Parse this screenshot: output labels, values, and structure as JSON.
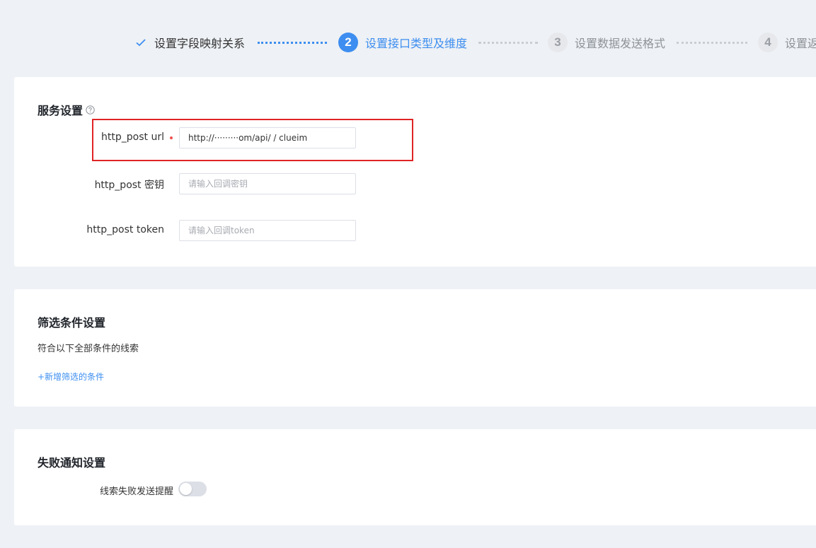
{
  "steps": [
    {
      "label": "设置字段映射关系",
      "state": "done",
      "icon": "check-icon"
    },
    {
      "number": "2",
      "label": "设置接口类型及维度",
      "state": "active"
    },
    {
      "number": "3",
      "label": "设置数据发送格式",
      "state": "todo"
    },
    {
      "number": "4",
      "label": "设置返",
      "state": "todo"
    }
  ],
  "service": {
    "title": "服务设置",
    "help_icon": "question-circle-icon",
    "url_label": "http_post url",
    "url_value": "http://·········om/api/ / clueim",
    "secret_label": "http_post 密钥",
    "secret_placeholder": "请输入回调密钥",
    "token_label": "http_post token",
    "token_placeholder": "请输入回调token"
  },
  "filter": {
    "title": "筛选条件设置",
    "description": "符合以下全部条件的线索",
    "add_label": "+新增筛选的条件"
  },
  "failure": {
    "title": "失败通知设置",
    "toggle_label": "线索失败发送提醒",
    "toggle_on": false
  },
  "colors": {
    "accent": "#3d8ef0",
    "highlight": "#e02424",
    "required": "#f05050",
    "background": "#eef1f5"
  }
}
